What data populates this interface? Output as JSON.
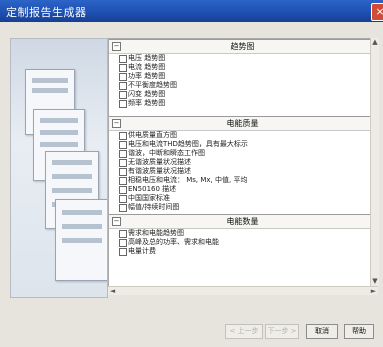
{
  "window": {
    "title": "定制报告生成器",
    "close_label": "×"
  },
  "groups": [
    {
      "title": "趋势图",
      "items": [
        "电压 趋势图",
        "电流 趋势图",
        "功率 趋势图",
        "不平衡度趋势图",
        "闪变 趋势图",
        "频率 趋势图"
      ]
    },
    {
      "title": "电能质量",
      "items": [
        "供电质量直方图",
        "电压和电流THD趋势图，具有最大标示",
        "谐波，中断和瞬态工作图",
        "无谐波质量状况描述",
        "有谐波质量状况描述",
        "相稳电压和电流： Ms, Mx, 中值, 平均",
        "EN50160 描述",
        "中国国家标准",
        "幅值/持续时间图"
      ]
    },
    {
      "title": "电能数量",
      "items": [
        "需求和电能趋势图",
        "高峰及总的功率、需求和电能",
        "电量计费"
      ]
    }
  ],
  "buttons": {
    "back": "< 上一步",
    "next": "下一步 >",
    "cancel": "取消",
    "help": "帮助"
  }
}
